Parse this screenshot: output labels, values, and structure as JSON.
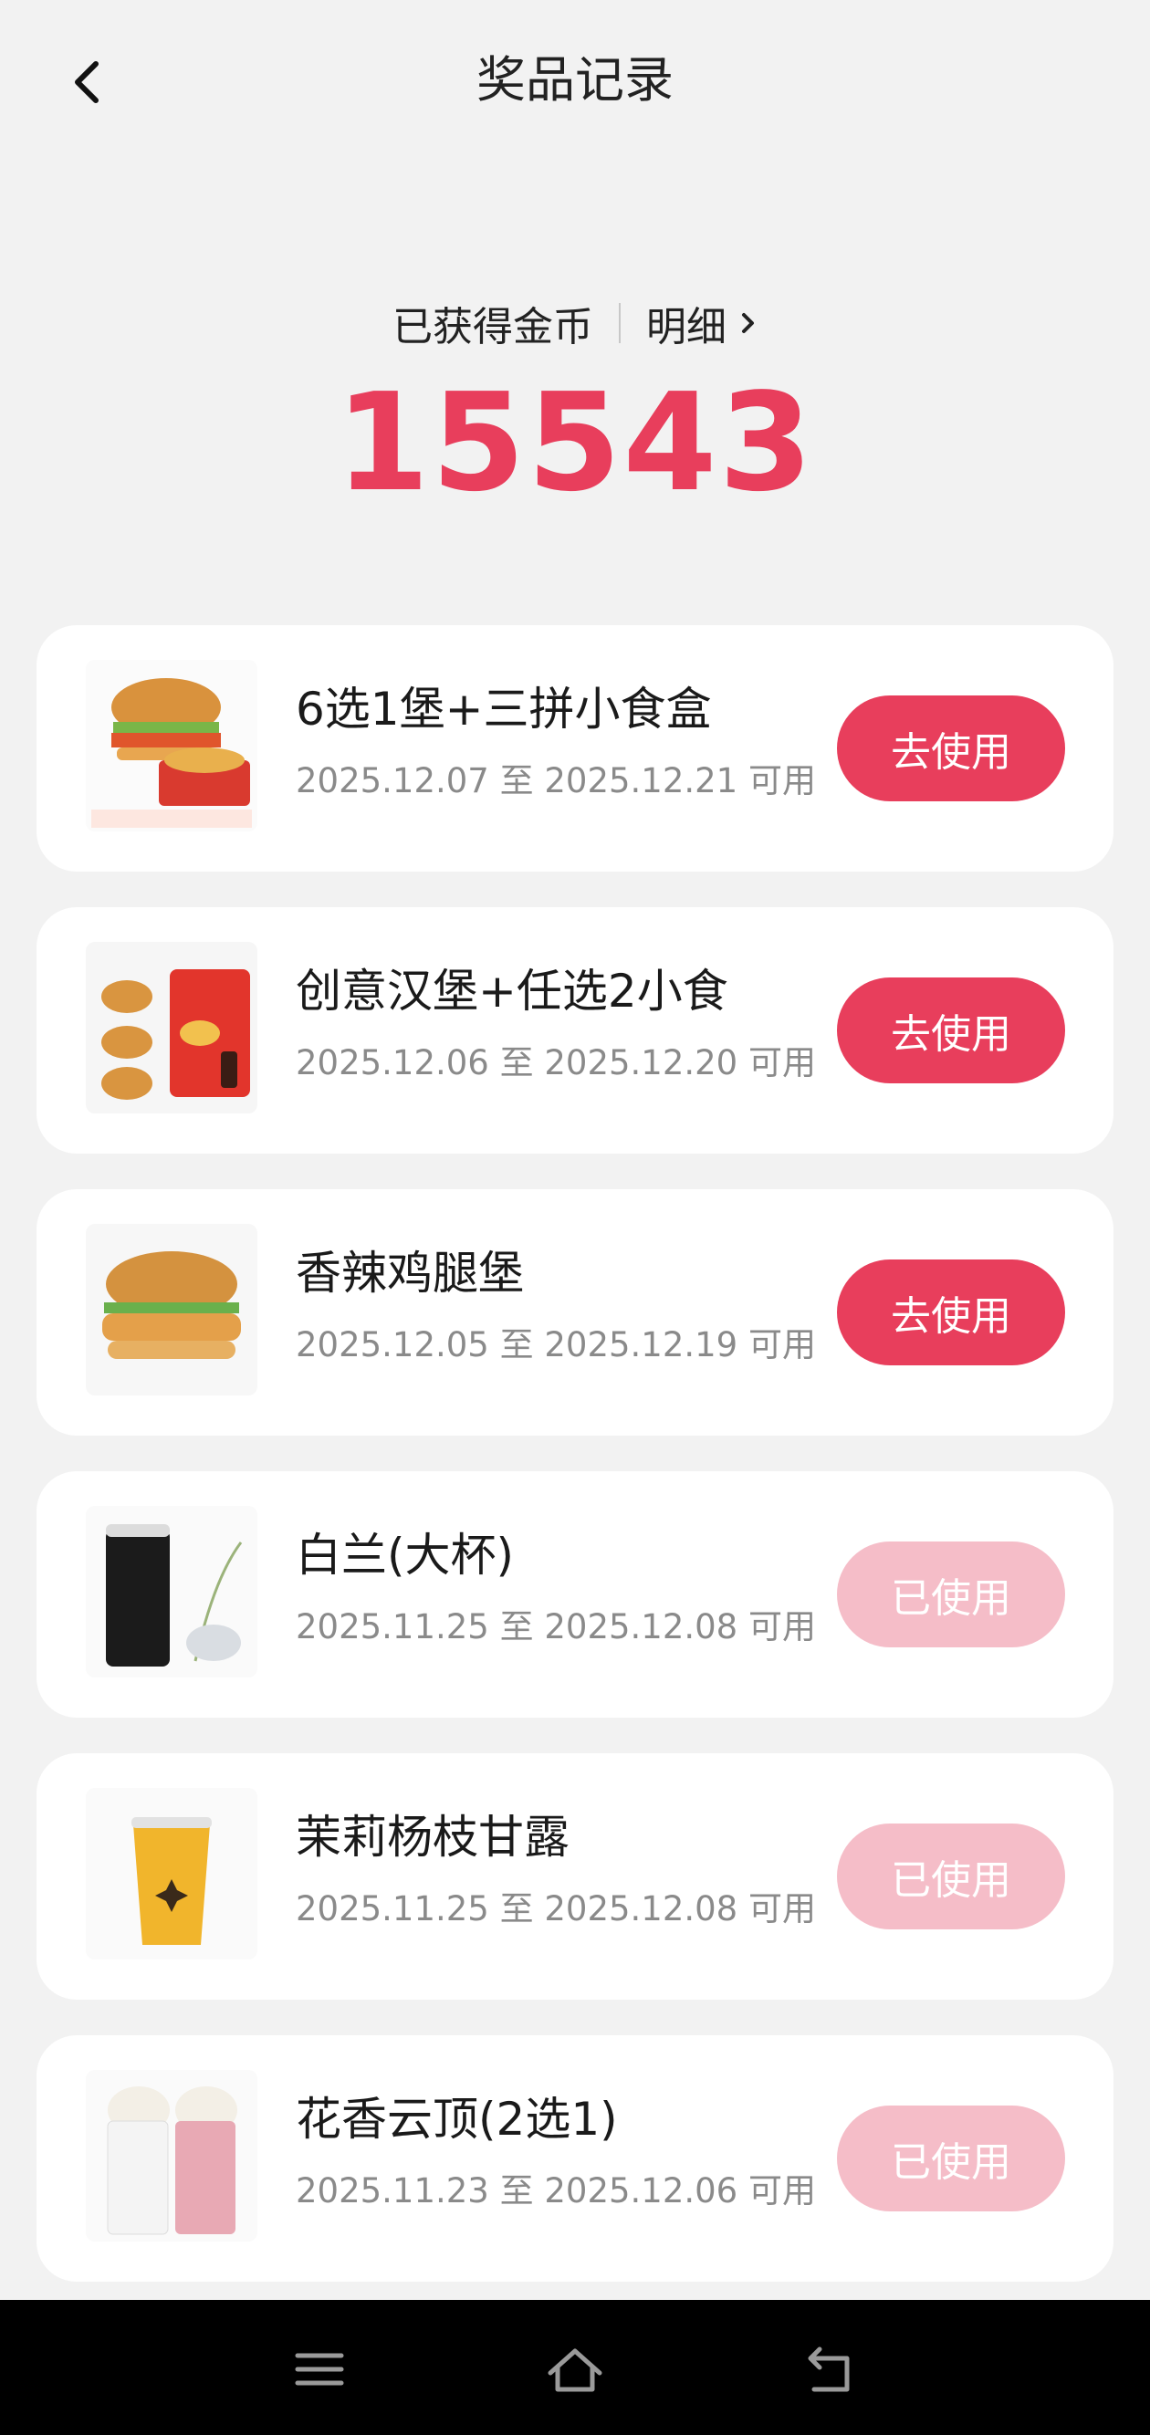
{
  "header": {
    "title": "奖品记录",
    "back_icon": "chevron-left-icon"
  },
  "coins": {
    "label": "已获得金币",
    "detail_label": "明细",
    "value": "15543",
    "accent_color": "#e83e5c"
  },
  "prizes": [
    {
      "name": "6选1堡+三拼小食盒",
      "validity": "2025.12.07 至 2025.12.21 可用",
      "button": "去使用",
      "status": "available"
    },
    {
      "name": "创意汉堡+任选2小食",
      "validity": "2025.12.06 至 2025.12.20 可用",
      "button": "去使用",
      "status": "available"
    },
    {
      "name": "香辣鸡腿堡",
      "validity": "2025.12.05 至 2025.12.19 可用",
      "button": "去使用",
      "status": "available"
    },
    {
      "name": "白兰(大杯)",
      "validity": "2025.11.25 至 2025.12.08 可用",
      "button": "已使用",
      "status": "used"
    },
    {
      "name": "茉莉杨枝甘露",
      "validity": "2025.11.25 至 2025.12.08 可用",
      "button": "已使用",
      "status": "used"
    },
    {
      "name": "花香云顶(2选1)",
      "validity": "2025.11.23 至 2025.12.06 可用",
      "button": "已使用",
      "status": "used"
    }
  ],
  "navbar": {
    "icons": [
      "menu-icon",
      "home-icon",
      "back-icon"
    ]
  }
}
